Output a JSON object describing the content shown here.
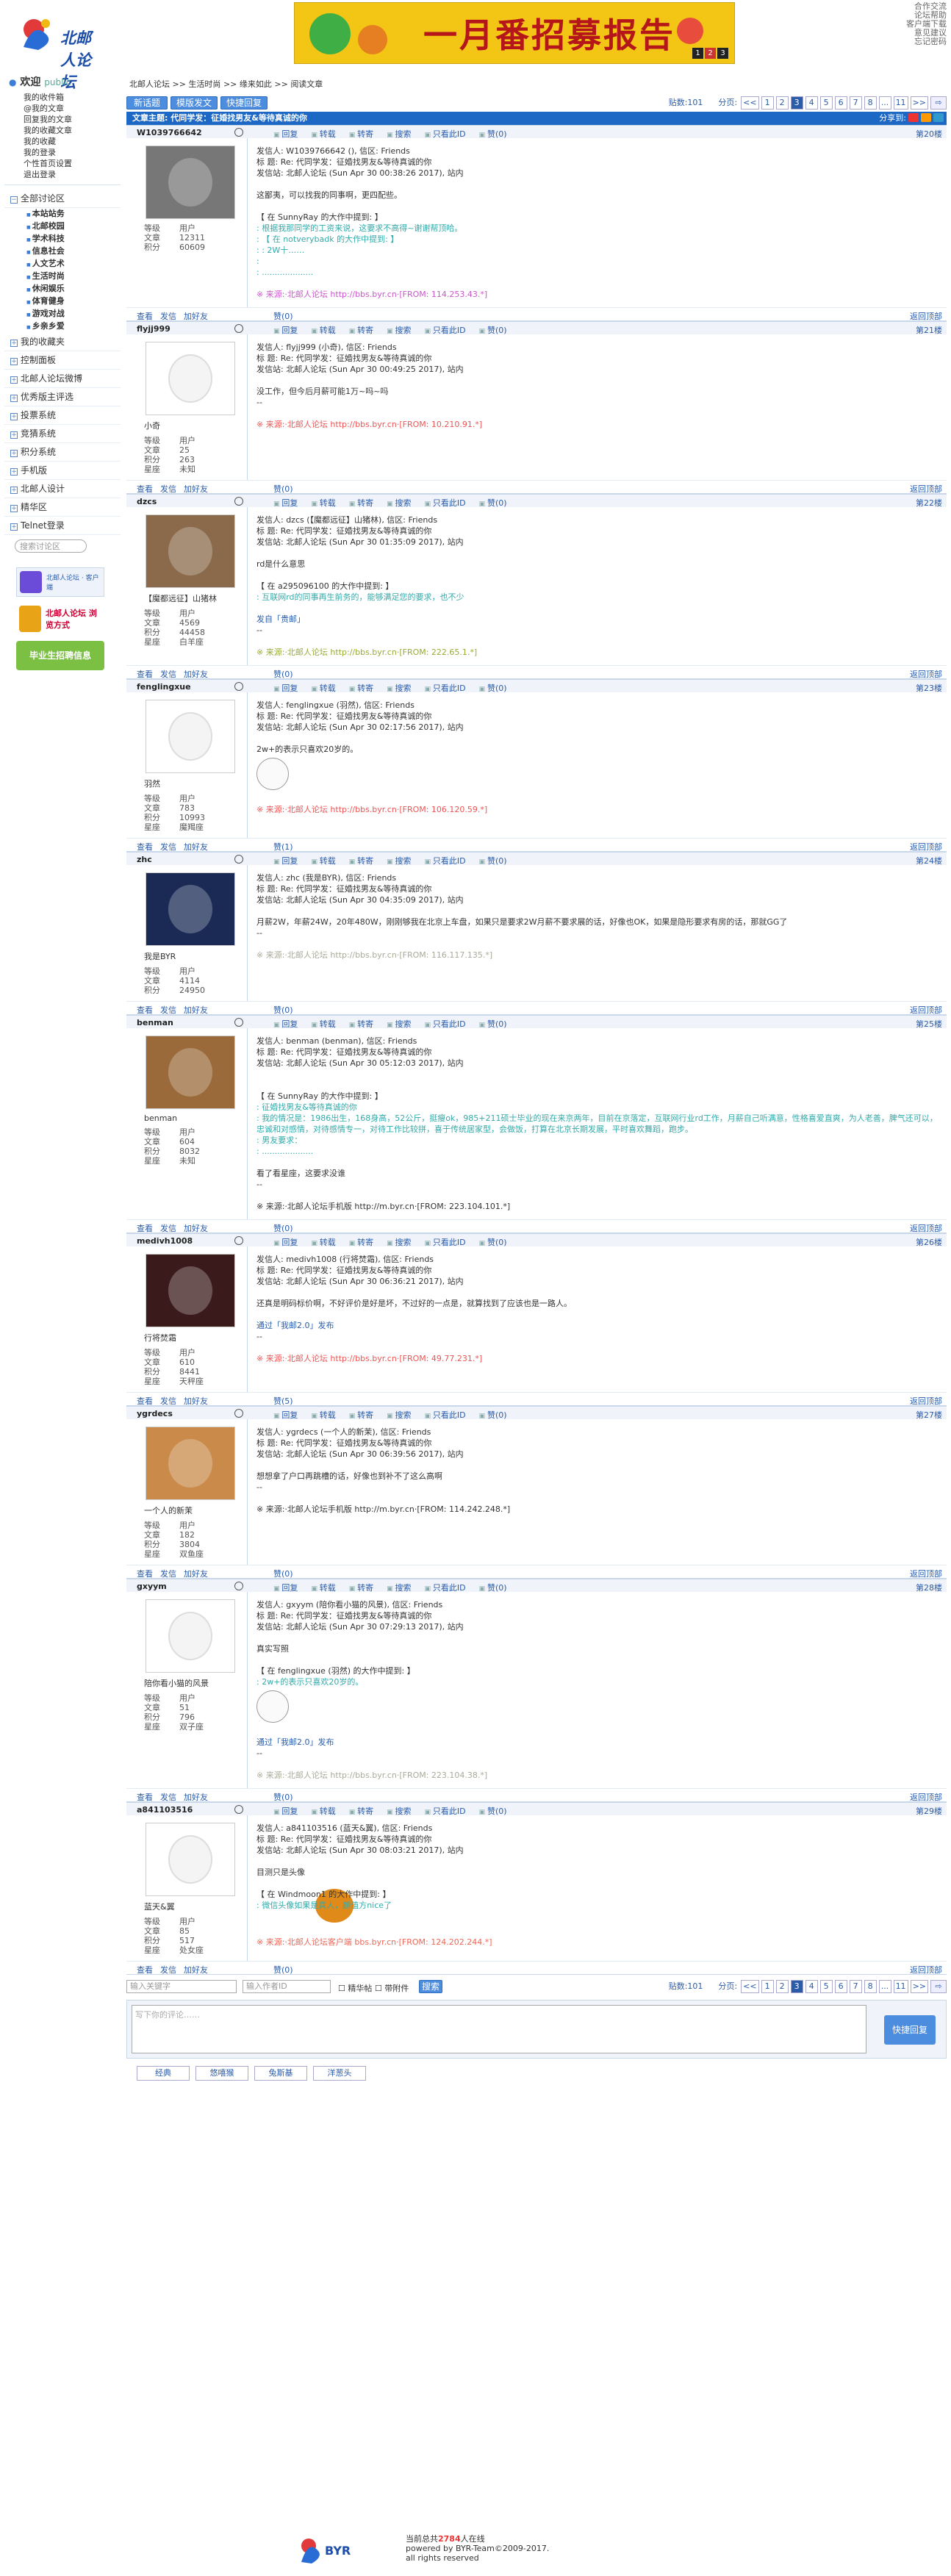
{
  "logo": {
    "text": "北邮人论坛"
  },
  "banner": {
    "text": "一月番招募报告",
    "pages": [
      "1",
      "2",
      "3"
    ]
  },
  "toplinks": [
    "合作交流",
    "论坛帮助",
    "客户端下载",
    "意见建议",
    "忘记密码"
  ],
  "sidebar": {
    "welcome": "欢迎",
    "user": "public",
    "links": [
      "我的收件箱",
      "@我的文章",
      "回复我的文章",
      "我的收藏文章",
      "我的收藏",
      "我的登录",
      "个性首页设置",
      "退出登录"
    ],
    "all_sections": "全部讨论区",
    "sections": [
      "本站站务",
      "北邮校园",
      "学术科技",
      "信息社会",
      "人文艺术",
      "生活时尚",
      "休闲娱乐",
      "体育健身",
      "游戏对战",
      "乡亲乡爱"
    ],
    "cats": [
      "我的收藏夹",
      "控制面板",
      "北邮人论坛微博",
      "优秀版主评选",
      "投票系统",
      "竞猜系统",
      "积分系统",
      "手机版",
      "北邮人设计",
      "精华区",
      "Telnet登录"
    ],
    "search_placeholder": "搜索讨论区",
    "ad1": "北邮人论坛 · 客户端",
    "ad2": "北邮人论坛 浏览方式",
    "ad3": "毕业生招聘信息"
  },
  "breadcrumb": [
    "北邮人论坛",
    ">>",
    "生活时尚",
    ">>",
    "缘来如此",
    ">>",
    "阅读文章"
  ],
  "toolbar": {
    "new": "新话题",
    "search": "模版发文",
    "quick": "快捷回复",
    "count": "贴数:101",
    "pagelabel": "分页:"
  },
  "pages": [
    "<<",
    "1",
    "2",
    "3",
    "4",
    "5",
    "6",
    "7",
    "8",
    "...",
    "11",
    ">>"
  ],
  "current_page": "3",
  "title": "文章主题: 代同学发：征婚找男友&等待真诚的你",
  "share_label": "分享到:",
  "actions": [
    "回复",
    "转载",
    "转寄",
    "搜索",
    "只看此ID",
    "赞(0)"
  ],
  "bottom_actions": [
    "查看",
    "发信",
    "加好友"
  ],
  "back": "返回顶部",
  "labels": {
    "level": "等级",
    "posts": "文章",
    "score": "积分",
    "star": "星座",
    "level_val": "用户"
  },
  "posts": [
    {
      "uid": "W1039766642",
      "floor": "第20楼",
      "nick": "",
      "posts": "12311",
      "score": "60609",
      "star": "",
      "zan": "赞(0)",
      "lines": [
        "发信人: W1039766642 (), 信区: Friends",
        "标 题: Re: 代同学发：征婚找男友&等待真诚的你",
        "发信站: 北邮人论坛 (Sun Apr 30 00:38:26 2017), 站内"
      ],
      "body": [
        "这鄙夷，可以找我的同事啊，更四配些。"
      ],
      "quote_head": "【 在 SunnyRay 的大作中提到: 】",
      "quote": [
        ": 根据我那同学的工资来说，这要求不高得~谢谢帮顶哈。",
        ": 【 在 notverybadk 的大作中提到: 】",
        ": : 2W十……",
        ": ",
        ": ...................."
      ],
      "src": "※ 来源:·北邮人论坛 http://bbs.byr.cn·[FROM: 114.253.43.*]",
      "srccls": "m"
    },
    {
      "uid": "flyjj999",
      "floor": "第21楼",
      "nick": "小奇",
      "posts": "25",
      "score": "263",
      "star": "未知",
      "zan": "赞(0)",
      "lines": [
        "发信人: flyjj999 (小奇), 信区: Friends",
        "标 题: Re: 代同学发：征婚找男友&等待真诚的你",
        "发信站: 北邮人论坛 (Sun Apr 30 00:49:25 2017), 站内"
      ],
      "body": [
        "没工作，但今后月薪可能1万~吗~吗",
        "--"
      ],
      "quote_head": "",
      "quote": [],
      "src": "※ 来源:·北邮人论坛 http://bbs.byr.cn·[FROM: 10.210.91.*]",
      "srccls": "p"
    },
    {
      "uid": "dzcs",
      "floor": "第22楼",
      "nick": "【魔都远征】山猪林",
      "posts": "4569",
      "score": "44458",
      "star": "白羊座",
      "zan": "赞(0)",
      "lines": [
        "发信人: dzcs (【魔都远征】山猪林), 信区: Friends",
        "标 题: Re: 代同学发：征婚找男友&等待真诚的你",
        "发信站: 北邮人论坛 (Sun Apr 30 01:35:09 2017), 站内"
      ],
      "body": [
        "rd是什么意思"
      ],
      "quote_head": "【 在 a295096100 的大作中提到: 】",
      "quote": [
        ": 互联网rd的同事再生前务的，能够满足您的要求，也不少"
      ],
      "sig": "发自「贵邮」",
      "src": "※ 来源:·北邮人论坛 http://bbs.byr.cn·[FROM: 222.65.1.*]",
      "srccls": "g"
    },
    {
      "uid": "fenglingxue",
      "floor": "第23楼",
      "nick": "羽然",
      "posts": "783",
      "score": "10993",
      "star": "魔羯座",
      "zan": "赞(1)",
      "lines": [
        "发信人: fenglingxue (羽然), 信区: Friends",
        "标 题: Re: 代同学发：征婚找男友&等待真诚的你",
        "发信站: 北邮人论坛 (Sun Apr 30 02:17:56 2017), 站内"
      ],
      "body": [
        "2w+的表示只喜欢20岁的。"
      ],
      "quote_head": "",
      "quote": [],
      "emoji": true,
      "src": "※ 来源:·北邮人论坛 http://bbs.byr.cn·[FROM: 106.120.59.*]",
      "srccls": "p"
    },
    {
      "uid": "zhc",
      "floor": "第24楼",
      "nick": "我是BYR",
      "posts": "4114",
      "score": "24950",
      "star": "",
      "zan": "赞(0)",
      "lines": [
        "发信人: zhc (我是BYR), 信区: Friends",
        "标 题: Re: 代同学发：征婚找男友&等待真诚的你",
        "发信站: 北邮人论坛 (Sun Apr 30 04:35:09 2017), 站内"
      ],
      "body": [
        "月薪2W，年薪24W，20年480W，刚刚够我在北京上车盘，如果只是要求2W月薪不要求展的话，好像也OK，如果是隐形要求有房的话，那就GG了",
        "--"
      ],
      "quote_head": "",
      "quote": [],
      "src": "※ 来源:·北邮人论坛 http://bbs.byr.cn·[FROM: 116.117.135.*]",
      "srccls": "o"
    },
    {
      "uid": "benman",
      "floor": "第25楼",
      "nick": "benman",
      "posts": "604",
      "score": "8032",
      "star": "未知",
      "zan": "赞(0)",
      "lines": [
        "发信人: benman (benman), 信区: Friends",
        "标 题: Re: 代同学发：征婚找男友&等待真诚的你",
        "发信站: 北邮人论坛 (Sun Apr 30 05:12:03 2017), 站内"
      ],
      "body": [],
      "quote_head": "【 在 SunnyRay 的大作中提到: 】",
      "quote": [
        ": 征婚找男友&等待真诚的你",
        ": 我的情况是：1986出生，168身高，52公斤，挺瘦ok，985+211硕士毕业的现在来京两年，目前在京落定，互联网行业rd工作，月薪自己听满意，性格喜爱直爽，为人老善，脾气还可以，忠诚和对感情，对待感情专一，对待工作比较拼，喜于传统居家型，会做饭，打算在北京长期发展，平时喜欢舞蹈，跑步。",
        ": 男友要求：",
        ": ...................."
      ],
      "body2": [
        "看了看星座，这要求没谁",
        "--"
      ],
      "src": "※ 来源:·北邮人论坛手机版 http://m.byr.cn·[FROM: 223.104.101.*]",
      "srccls": "b"
    },
    {
      "uid": "medivh1008",
      "floor": "第26楼",
      "nick": "行将焚霜",
      "posts": "610",
      "score": "8441",
      "star": "天秤座",
      "zan": "赞(5)",
      "lines": [
        "发信人: medivh1008 (行将焚霜), 信区: Friends",
        "标 题: Re: 代同学发：征婚找男友&等待真诚的你",
        "发信站: 北邮人论坛 (Sun Apr 30 06:36:21 2017), 站内"
      ],
      "body": [
        "还真是明码标价啊，不好评价是好是坏，不过好的一点是，就算找到了应该也是一路人。"
      ],
      "quote_head": "",
      "quote": [],
      "sig": "通过「我邮2.0」发布",
      "src": "※ 来源:·北邮人论坛 http://bbs.byr.cn·[FROM: 49.77.231.*]",
      "srccls": "p"
    },
    {
      "uid": "ygrdecs",
      "floor": "第27楼",
      "nick": "一个人的新茉",
      "posts": "182",
      "score": "3804",
      "star": "双鱼座",
      "zan": "赞(0)",
      "lines": [
        "发信人: ygrdecs (一个人的新茉), 信区: Friends",
        "标 题: Re: 代同学发：征婚找男友&等待真诚的你",
        "发信站: 北邮人论坛 (Sun Apr 30 06:39:56 2017), 站内"
      ],
      "body": [
        "想想拿了户口再跳槽的话，好像也到补不了这么高啊",
        "--"
      ],
      "quote_head": "",
      "quote": [],
      "src": "※ 来源:·北邮人论坛手机版 http://m.byr.cn·[FROM: 114.242.248.*]",
      "srccls": "b"
    },
    {
      "uid": "gxyym",
      "floor": "第28楼",
      "nick": "陪你看小猫的风景",
      "posts": "51",
      "score": "796",
      "star": "双子座",
      "zan": "赞(0)",
      "lines": [
        "发信人: gxyym (陪你看小猫的风景), 信区: Friends",
        "标 题: Re: 代同学发：征婚找男友&等待真诚的你",
        "发信站: 北邮人论坛 (Sun Apr 30 07:29:13 2017), 站内"
      ],
      "body": [
        "真实写照"
      ],
      "quote_head": "【 在 fenglingxue (羽然) 的大作中提到: 】",
      "quote": [
        ": 2w+的表示只喜欢20岁的。"
      ],
      "emoji": true,
      "sig": "通过「我邮2.0」发布",
      "src": "※ 来源:·北邮人论坛 http://bbs.byr.cn·[FROM: 223.104.38.*]",
      "srccls": "o"
    },
    {
      "uid": "a841103516",
      "floor": "第29楼",
      "nick": "蓝天&翼",
      "posts": "85",
      "score": "517",
      "star": "处女座",
      "zan": "赞(0)",
      "lines": [
        "发信人: a841103516 (蓝天&翼), 信区: Friends",
        "标 题: Re: 代同学发：征婚找男友&等待真诚的你",
        "发信站: 北邮人论坛 (Sun Apr 30 08:03:21 2017), 站内"
      ],
      "body": [
        "目测只是头像"
      ],
      "quote_head": "【 在 Windmoon1 的大作中提到: 】",
      "quote": [
        ": 微信头像如果是真人，颜值方nice了"
      ],
      "monkey": true,
      "src": "※ 来源:·北邮人论坛客户端 bbs.byr.cn·[FROM: 124.202.244.*]",
      "srccls": "q"
    }
  ],
  "bottombar": {
    "keyword": "输入关键字",
    "userid": "输入作者ID",
    "jinghua": "精华帖",
    "attach": "带附件",
    "search": "搜索"
  },
  "reply": {
    "placeholder": "写下你的评论……",
    "submit": "快捷回复"
  },
  "emotions": [
    "经典",
    "悠嘻猴",
    "兔斯基",
    "洋葱头"
  ],
  "footer": {
    "line1a": "当前总共",
    "online": "2784",
    "line1b": "人在线",
    "line2": "powered by BYR-Team©2009-2017.",
    "line3": "all rights reserved"
  }
}
